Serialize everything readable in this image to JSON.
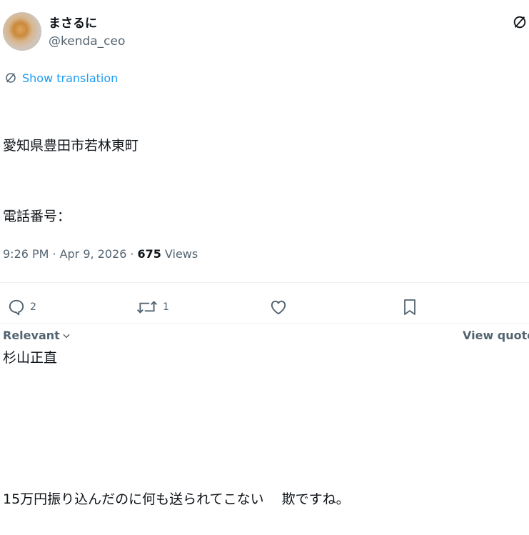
{
  "author": {
    "display_name": "まさるに",
    "handle": "@kenda_ceo"
  },
  "translation": {
    "label": "Show translation"
  },
  "tweet": {
    "lines": [
      "愛知県豊田市若林東町",
      "電話番号：",
      "",
      "杉山正直",
      "",
      "15万円振り込んだのに何も送られてこない　 欺ですね。"
    ]
  },
  "meta": {
    "time": "9:26 PM",
    "date": "Apr 9, 2026",
    "views_count": "675",
    "views_label": "Views",
    "separator": "·"
  },
  "actions": {
    "reply_count": "2",
    "retweet_count": "1"
  },
  "footer": {
    "sort_label": "Relevant",
    "view_quotes_label": "View quotes"
  },
  "colors": {
    "text": "#0f1419",
    "secondary": "#536471",
    "link": "#1d9bf0",
    "border": "#eff3f4"
  },
  "icons": {
    "header": "grok-icon",
    "translation": "grok-icon",
    "reply": "reply-icon",
    "retweet": "retweet-icon",
    "like": "heart-icon",
    "bookmark": "bookmark-icon",
    "dropdown": "chevron-down-icon"
  }
}
